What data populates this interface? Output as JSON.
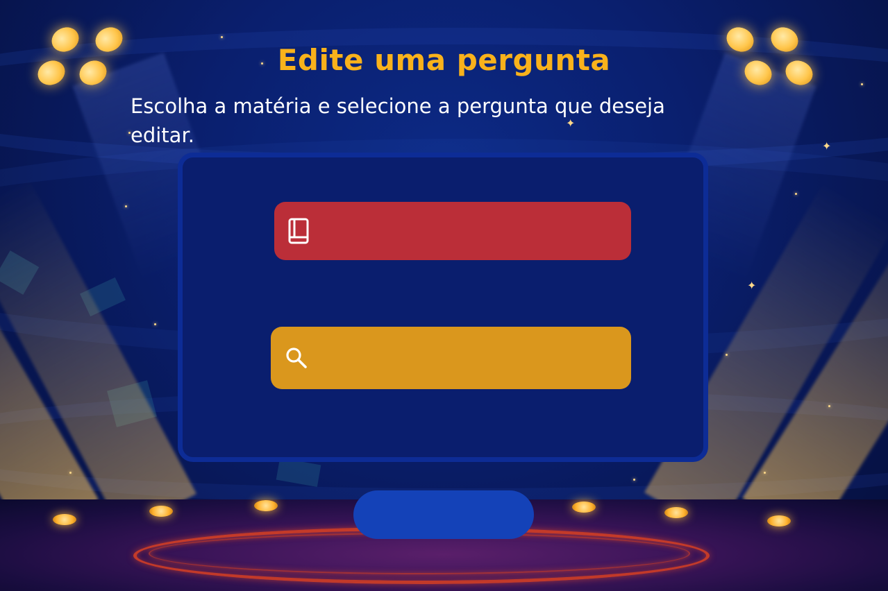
{
  "page": {
    "title": "Edite uma pergunta",
    "subtitle": "Escolha a matéria e selecione a pergunta que deseja editar."
  },
  "form": {
    "subject_select": {
      "icon": "book-icon",
      "value": "",
      "color": "#bb2e38"
    },
    "question_search": {
      "icon": "search-icon",
      "value": "",
      "color": "#da971d"
    },
    "confirm_button": {
      "label": "",
      "color": "#1442b8"
    }
  },
  "colors": {
    "title": "#f9b21b",
    "panel_bg": "#0a1e6e",
    "panel_border": "#0d2c96"
  }
}
